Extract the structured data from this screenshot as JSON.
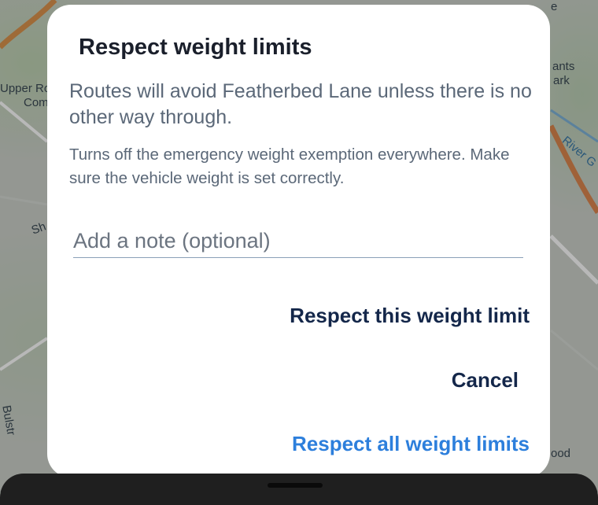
{
  "map": {
    "labels": [
      "Upper Ro",
      "Com",
      "ants",
      "ark",
      "River G",
      "Sh",
      "Bulstr",
      "ood",
      "e"
    ]
  },
  "dialog": {
    "title": "Respect weight limits",
    "body": "Routes will avoid Featherbed Lane unless there is no other way through.",
    "hint": "Turns off the emergency weight exemption everywhere. Make sure the vehicle weight is set correctly.",
    "note_placeholder": "Add a note (optional)",
    "note_value": "",
    "buttons": {
      "respect_this": "Respect this weight limit",
      "cancel": "Cancel",
      "respect_all": "Respect all weight limits"
    }
  },
  "colors": {
    "title": "#1a1f2b",
    "body_text": "#5b6878",
    "primary_button": "#14274a",
    "accent_button": "#2d7fdc",
    "dialog_bg": "#ffffff"
  }
}
